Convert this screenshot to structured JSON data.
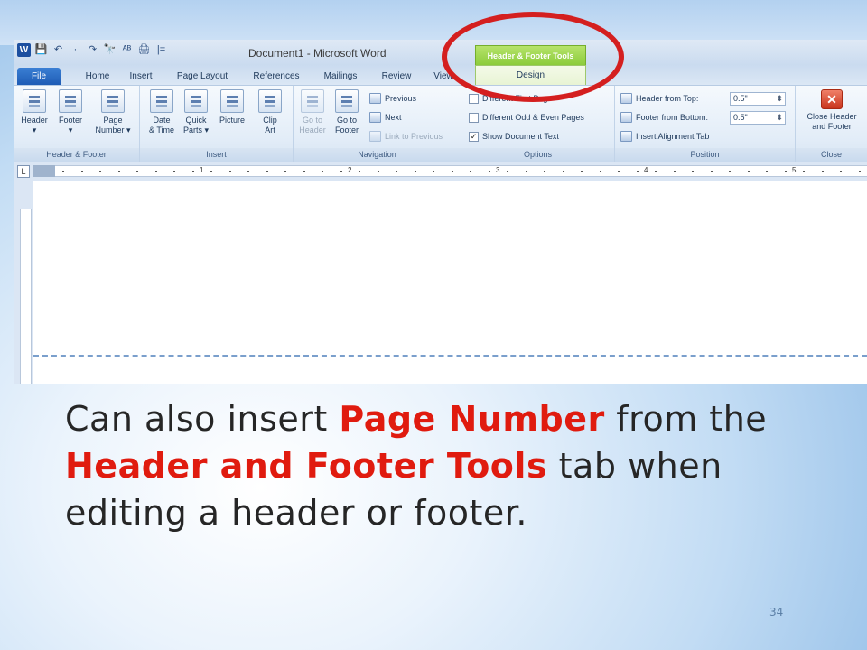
{
  "window": {
    "title": "Document1  -  Microsoft Word",
    "contextual_tab_title": "Header & Footer Tools",
    "quick_access": [
      "W",
      "💾",
      "↶",
      "·",
      "↷",
      "🔭",
      "ᴬᴮ",
      "🖨",
      "|="
    ]
  },
  "tabs": [
    {
      "label": "File"
    },
    {
      "label": "Home"
    },
    {
      "label": "Insert"
    },
    {
      "label": "Page Layout"
    },
    {
      "label": "References"
    },
    {
      "label": "Mailings"
    },
    {
      "label": "Review"
    },
    {
      "label": "View"
    },
    {
      "label": "Design"
    }
  ],
  "ribbon": {
    "header_footer": {
      "label": "Header & Footer",
      "header": "Header\n▾",
      "footer": "Footer\n▾",
      "page_number": "Page\nNumber ▾"
    },
    "insert": {
      "label": "Insert",
      "date_time": "Date\n& Time",
      "quick_parts": "Quick\nParts ▾",
      "picture": "Picture",
      "clip_art": "Clip\nArt"
    },
    "navigation": {
      "label": "Navigation",
      "go_to_header": "Go to\nHeader",
      "go_to_footer": "Go to\nFooter",
      "previous": "Previous",
      "next": "Next",
      "link_to_previous": "Link to Previous"
    },
    "options": {
      "label": "Options",
      "different_first_page": "Different First Page",
      "different_odd_even": "Different Odd & Even Pages",
      "show_document_text": "Show Document Text",
      "show_document_text_checked": "✓"
    },
    "position": {
      "label": "Position",
      "header_from_top": "Header from Top:",
      "header_from_top_value": "0.5\"",
      "footer_from_bottom": "Footer from Bottom:",
      "footer_from_bottom_value": "0.5\"",
      "insert_alignment_tab": "Insert Alignment Tab"
    },
    "close": {
      "label": "Close",
      "close_header_footer": "Close Header\nand Footer",
      "close_glyph": "✕"
    }
  },
  "ruler": {
    "tab_marker": "L",
    "numbers": [
      "1",
      "2",
      "3",
      "4",
      "5"
    ]
  },
  "caption": {
    "part1": "Can also insert ",
    "highlight1": "Page Number",
    "part2": " from the ",
    "highlight2": "Header and Footer Tools",
    "part3": " tab when editing a header or footer."
  },
  "slide_number": "34",
  "colors": {
    "highlight_text": "#e01b0f",
    "oval": "#d41f1f",
    "contextual_tab": "#8ccc3c"
  }
}
